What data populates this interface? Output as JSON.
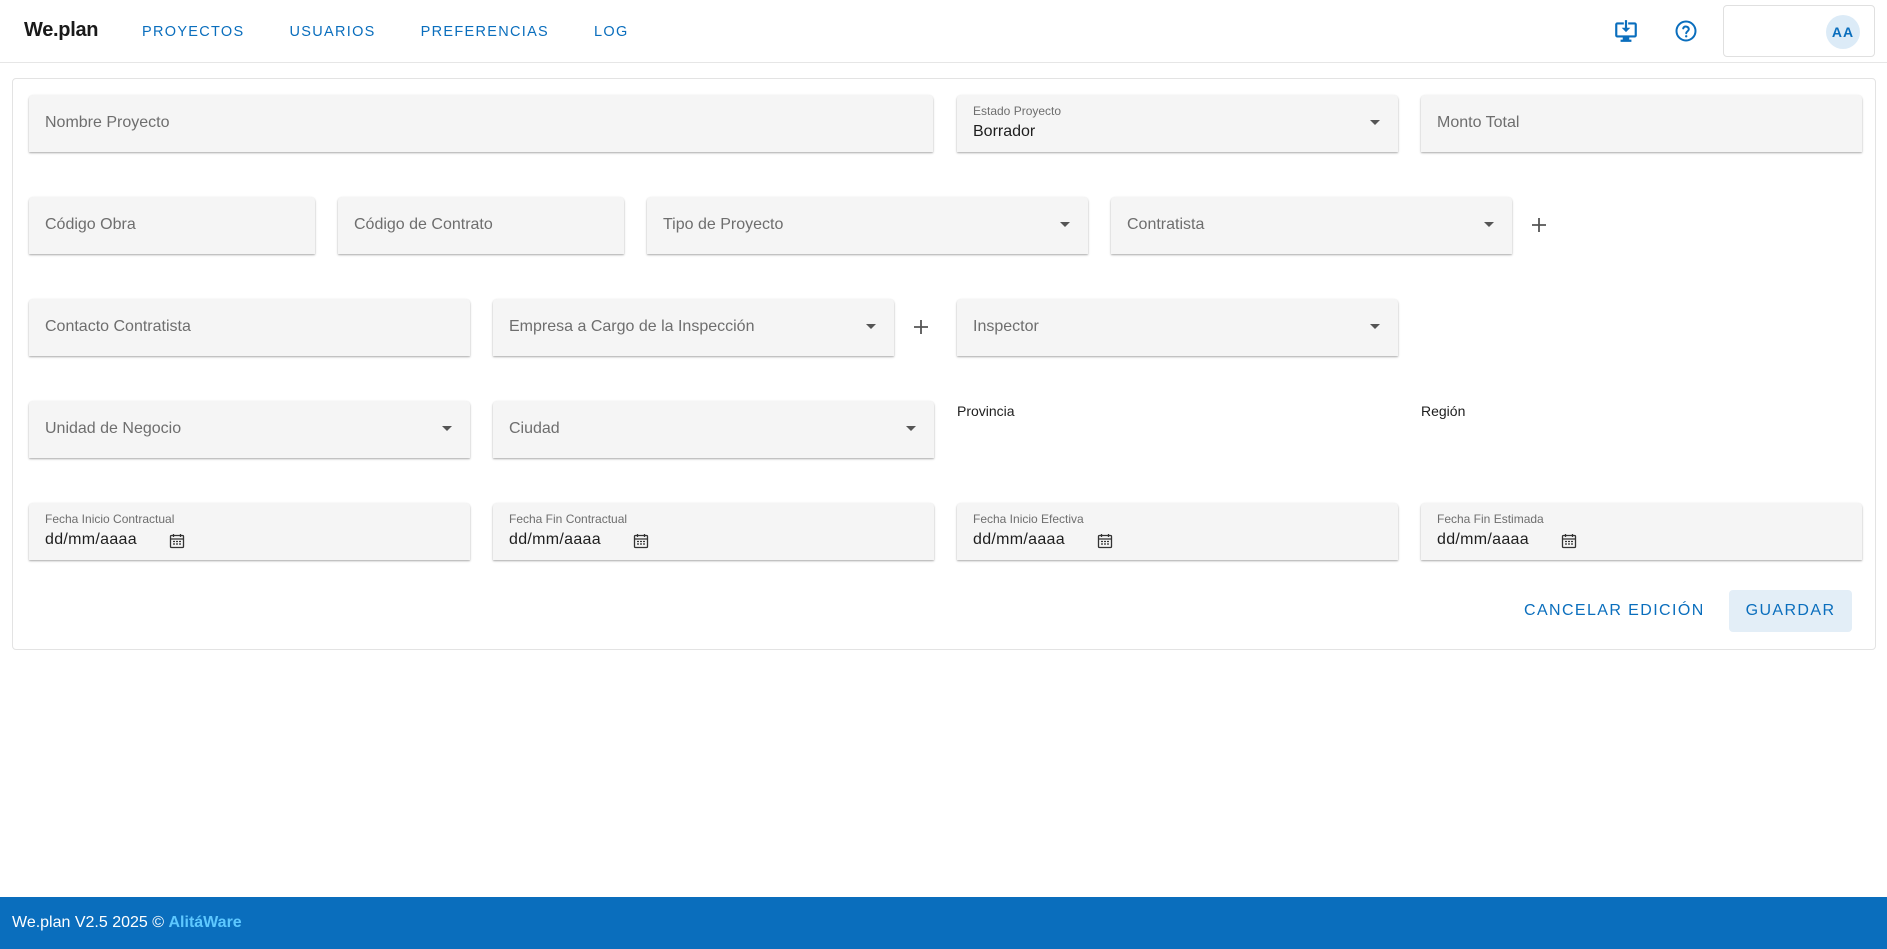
{
  "app": {
    "logo": "We.plan"
  },
  "nav": {
    "items": [
      {
        "label": "PROYECTOS"
      },
      {
        "label": "USUARIOS"
      },
      {
        "label": "PREFERENCIAS"
      },
      {
        "label": "LOG"
      }
    ]
  },
  "header": {
    "download_icon": "download-to-desktop-icon",
    "help_icon": "help-circle-icon",
    "user_initials": "AA"
  },
  "form": {
    "nombre_proyecto": {
      "placeholder": "Nombre Proyecto"
    },
    "estado_proyecto": {
      "label": "Estado Proyecto",
      "value": "Borrador"
    },
    "monto_total": {
      "placeholder": "Monto Total"
    },
    "codigo_obra": {
      "placeholder": "Código Obra"
    },
    "codigo_contrato": {
      "placeholder": "Código de Contrato"
    },
    "tipo_proyecto": {
      "placeholder": "Tipo de Proyecto"
    },
    "contratista": {
      "placeholder": "Contratista"
    },
    "contacto_contratista": {
      "placeholder": "Contacto Contratista"
    },
    "empresa_inspeccion": {
      "placeholder": "Empresa a Cargo de la Inspección"
    },
    "inspector": {
      "placeholder": "Inspector"
    },
    "unidad_negocio": {
      "placeholder": "Unidad de Negocio"
    },
    "ciudad": {
      "placeholder": "Ciudad"
    },
    "provincia": {
      "label": "Provincia"
    },
    "region": {
      "label": "Región"
    },
    "fecha_inicio_contractual": {
      "label": "Fecha Inicio Contractual",
      "value": "dd/mm/aaaa"
    },
    "fecha_fin_contractual": {
      "label": "Fecha Fin Contractual",
      "value": "dd/mm/aaaa"
    },
    "fecha_inicio_efectiva": {
      "label": "Fecha Inicio Efectiva",
      "value": "dd/mm/aaaa"
    },
    "fecha_fin_estimada": {
      "label": "Fecha Fin Estimada",
      "value": "dd/mm/aaaa"
    }
  },
  "actions": {
    "cancel_label": "CANCELAR EDICIÓN",
    "save_label": "GUARDAR"
  },
  "footer": {
    "text": "We.plan V2.5 2025 ©",
    "brand": "AlitáWare"
  },
  "colors": {
    "primary": "#0a6ebd",
    "footer_bg": "#0a6ebd",
    "footer_brand": "#5ec8ff",
    "field_bg": "#f5f5f5"
  }
}
